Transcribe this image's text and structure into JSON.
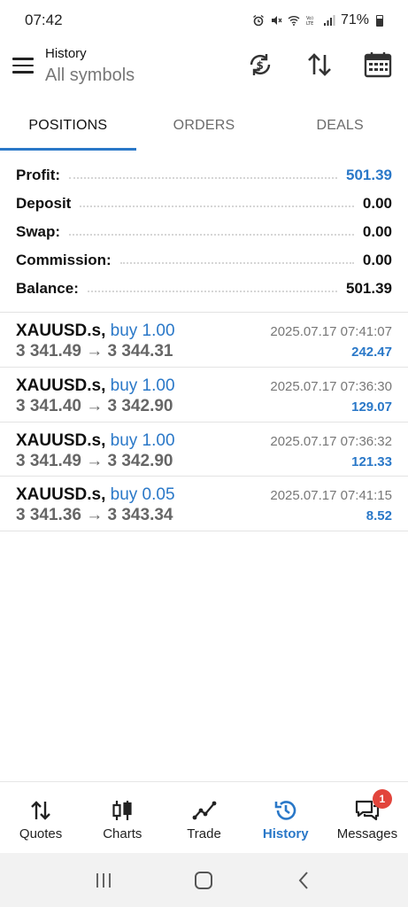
{
  "status_bar": {
    "time": "07:42",
    "battery": "71%",
    "icons": [
      "alarm-icon",
      "mute-icon",
      "wifi-icon",
      "volte-icon",
      "signal-icon",
      "battery-icon"
    ]
  },
  "header": {
    "title": "History",
    "subtitle": "All symbols",
    "icons": [
      "sync-currency-icon",
      "sort-icon",
      "calendar-icon"
    ]
  },
  "tabs": [
    {
      "label": "POSITIONS",
      "active": true
    },
    {
      "label": "ORDERS",
      "active": false
    },
    {
      "label": "DEALS",
      "active": false
    }
  ],
  "summary": [
    {
      "label": "Profit:",
      "value": "501.39",
      "highlight": true
    },
    {
      "label": "Deposit",
      "value": "0.00",
      "highlight": false
    },
    {
      "label": "Swap:",
      "value": "0.00",
      "highlight": false
    },
    {
      "label": "Commission:",
      "value": "0.00",
      "highlight": false
    },
    {
      "label": "Balance:",
      "value": "501.39",
      "highlight": false
    }
  ],
  "positions": [
    {
      "symbol": "XAUUSD.s,",
      "direction": "buy 1.00",
      "prices": "3 341.49 → 3 344.31",
      "time": "2025.07.17 07:41:07",
      "profit": "242.47"
    },
    {
      "symbol": "XAUUSD.s,",
      "direction": "buy 1.00",
      "prices": "3 341.40 → 3 342.90",
      "time": "2025.07.17 07:36:30",
      "profit": "129.07"
    },
    {
      "symbol": "XAUUSD.s,",
      "direction": "buy 1.00",
      "prices": "3 341.49 → 3 342.90",
      "time": "2025.07.17 07:36:32",
      "profit": "121.33"
    },
    {
      "symbol": "XAUUSD.s,",
      "direction": "buy 0.05",
      "prices": "3 341.36 → 3 343.34",
      "time": "2025.07.17 07:41:15",
      "profit": "8.52"
    }
  ],
  "bottom_nav": [
    {
      "label": "Quotes",
      "icon": "quotes-icon",
      "active": false
    },
    {
      "label": "Charts",
      "icon": "charts-icon",
      "active": false
    },
    {
      "label": "Trade",
      "icon": "trade-icon",
      "active": false
    },
    {
      "label": "History",
      "icon": "history-icon",
      "active": true
    },
    {
      "label": "Messages",
      "icon": "messages-icon",
      "active": false,
      "badge": "1"
    }
  ],
  "colors": {
    "accent": "#2a78c8",
    "badge": "#e2453c"
  }
}
